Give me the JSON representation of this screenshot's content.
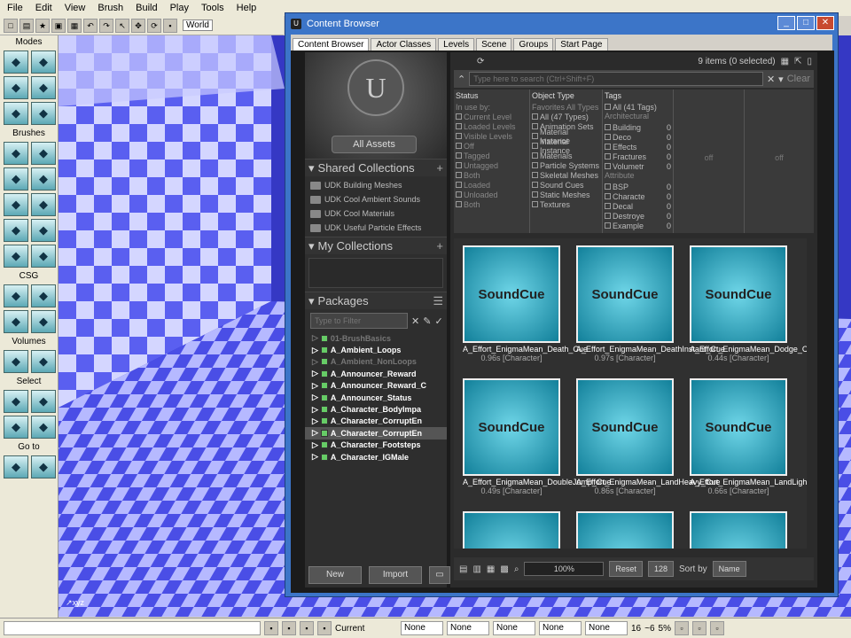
{
  "menubar": [
    "File",
    "Edit",
    "View",
    "Brush",
    "Build",
    "Play",
    "Tools",
    "Help"
  ],
  "toolbar": {
    "world_label": "World"
  },
  "left_panel": {
    "sections": [
      "Modes",
      "Brushes",
      "CSG",
      "Volumes",
      "Select",
      "Go to"
    ]
  },
  "content_browser": {
    "title": "Content Browser",
    "tabs": [
      "Content Browser",
      "Actor Classes",
      "Levels",
      "Scene",
      "Groups",
      "Start Page"
    ],
    "all_assets": "All Assets",
    "shared_collections_label": "Shared Collections",
    "shared_collections": [
      "UDK Building Meshes",
      "UDK Cool Ambient Sounds",
      "UDK Cool Materials",
      "UDK Useful Particle Effects"
    ],
    "my_collections_label": "My Collections",
    "packages_label": "Packages",
    "filter_placeholder": "Type to Filter",
    "packages": [
      {
        "name": "01-BrushBasics",
        "dim": true
      },
      {
        "name": "A_Ambient_Loops",
        "dim": false
      },
      {
        "name": "A_Ambient_NonLoops",
        "dim": true
      },
      {
        "name": "A_Announcer_Reward",
        "dim": false
      },
      {
        "name": "A_Announcer_Reward_C",
        "dim": false
      },
      {
        "name": "A_Announcer_Status",
        "dim": false
      },
      {
        "name": "A_Character_BodyImpa",
        "dim": false
      },
      {
        "name": "A_Character_CorruptEn",
        "dim": false
      },
      {
        "name": "A_Character_CorruptEn",
        "dim": false,
        "selected": true
      },
      {
        "name": "A_Character_Footsteps",
        "dim": false
      },
      {
        "name": "A_Character_IGMale",
        "dim": false
      }
    ],
    "new_button": "New",
    "import_button": "Import",
    "items_count": "9 items (0 selected)",
    "search_placeholder": "Type here to search (Ctrl+Shift+F)",
    "clear_button": "Clear",
    "filter_headers": {
      "status": "Status",
      "object_type": "Object Type",
      "tags": "Tags"
    },
    "status_items": [
      "In use by:",
      "Current Level",
      "Loaded Levels",
      "Visible Levels",
      "Off",
      "Tagged",
      "Untagged",
      "Both",
      "Loaded",
      "Unloaded",
      "Both"
    ],
    "object_tabs": [
      "Favorites",
      "All Types"
    ],
    "object_types": [
      "All (47 Types)",
      "Animation Sets",
      "Material Instance",
      "Material Instance",
      "Materials",
      "Particle Systems",
      "Skeletal Meshes",
      "Sound Cues",
      "Static Meshes",
      "Textures"
    ],
    "tags_all": "All (41 Tags)",
    "tag_groups": [
      {
        "group": "Architectural",
        "tags": [
          [
            "Building",
            "0"
          ],
          [
            "Deco",
            "0"
          ],
          [
            "Effects",
            "0"
          ],
          [
            "Fractures",
            "0"
          ],
          [
            "Volumetr",
            "0"
          ]
        ]
      },
      {
        "group": "Attribute",
        "tags": [
          [
            "BSP",
            "0"
          ],
          [
            "Characte",
            "0"
          ],
          [
            "Decal",
            "0"
          ],
          [
            "Destroye",
            "0"
          ],
          [
            "Example",
            "0"
          ]
        ]
      }
    ],
    "off_labels": [
      "off",
      "off"
    ],
    "assets": [
      {
        "thumb": "SoundCue",
        "name": "A_Effort_EnigmaMean_Death_Cue",
        "info": "0.96s [Character]"
      },
      {
        "thumb": "SoundCue",
        "name": "A_Effort_EnigmaMean_DeathInstant_Cue",
        "info": "0.97s [Character]"
      },
      {
        "thumb": "SoundCue",
        "name": "A_Effort_EnigmaMean_Dodge_Cue",
        "info": "0.44s [Character]"
      },
      {
        "thumb": "SoundCue",
        "name": "A_Effort_EnigmaMean_DoubleJump_Cue",
        "info": "0.49s [Character]"
      },
      {
        "thumb": "SoundCue",
        "name": "A_Effort_EnigmaMean_LandHeavy_Cue",
        "info": "0.86s [Character]"
      },
      {
        "thumb": "SoundCue",
        "name": "A_Effort_EnigmaMean_LandLight_Cue",
        "info": "0.66s [Character]"
      },
      {
        "thumb": "",
        "name": "",
        "info": ""
      },
      {
        "thumb": "",
        "name": "",
        "info": ""
      },
      {
        "thumb": "",
        "name": "",
        "info": ""
      }
    ],
    "zoom": "100%",
    "reset_button": "Reset",
    "size_value": "128",
    "sort_label": "Sort by",
    "sort_value": "Name"
  },
  "statusbar": {
    "current": "Current",
    "fields": [
      "None",
      "None",
      "None",
      "None",
      "None"
    ],
    "grid": "16",
    "rot": "~6",
    "scale": "5%"
  }
}
